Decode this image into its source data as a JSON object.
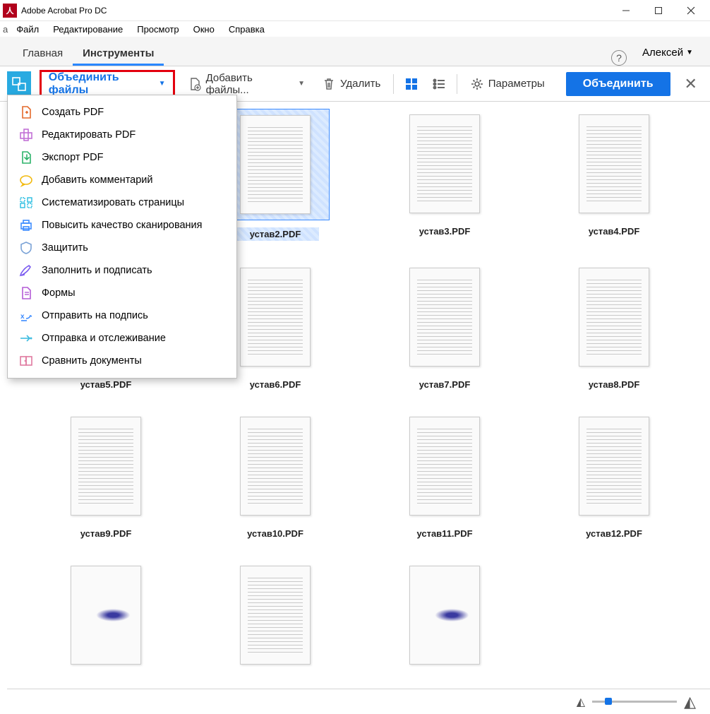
{
  "titlebar": {
    "app_name": "Adobe Acrobat Pro DC"
  },
  "menubar": {
    "items": [
      "Файл",
      "Редактирование",
      "Просмотр",
      "Окно",
      "Справка"
    ],
    "prefix": "а"
  },
  "tabs": {
    "home": "Главная",
    "tools": "Инструменты",
    "user": "Алексей"
  },
  "toolbar": {
    "combine": "Объединить файлы",
    "add_files": "Добавить файлы...",
    "delete": "Удалить",
    "options": "Параметры",
    "action": "Объединить"
  },
  "dropdown": {
    "items": [
      {
        "label": "Создать PDF",
        "color": "#e46a2c"
      },
      {
        "label": "Редактировать PDF",
        "color": "#c271d6"
      },
      {
        "label": "Экспорт PDF",
        "color": "#2db36a"
      },
      {
        "label": "Добавить комментарий",
        "color": "#f2b90c"
      },
      {
        "label": "Систематизировать страницы",
        "color": "#29bde0"
      },
      {
        "label": "Повысить качество сканирования",
        "color": "#3b8bff"
      },
      {
        "label": "Защитить",
        "color": "#7aa2d6"
      },
      {
        "label": "Заполнить и подписать",
        "color": "#7a5af0"
      },
      {
        "label": "Формы",
        "color": "#b45bd6"
      },
      {
        "label": "Отправить на подпись",
        "color": "#3b8bff"
      },
      {
        "label": "Отправка и отслеживание",
        "color": "#3fbce0"
      },
      {
        "label": "Сравнить документы",
        "color": "#e07aa0"
      }
    ]
  },
  "files": [
    {
      "name": "устав2.PDF",
      "selected": true
    },
    {
      "name": "устав3.PDF"
    },
    {
      "name": "устав4.PDF"
    },
    {
      "name": "устав5.PDF"
    },
    {
      "name": "устав6.PDF"
    },
    {
      "name": "устав7.PDF"
    },
    {
      "name": "устав8.PDF"
    },
    {
      "name": "устав9.PDF"
    },
    {
      "name": "устав10.PDF"
    },
    {
      "name": "устав11.PDF"
    },
    {
      "name": "устав12.PDF"
    },
    {
      "name": "",
      "special": true
    },
    {
      "name": ""
    },
    {
      "name": "",
      "special": true
    }
  ]
}
